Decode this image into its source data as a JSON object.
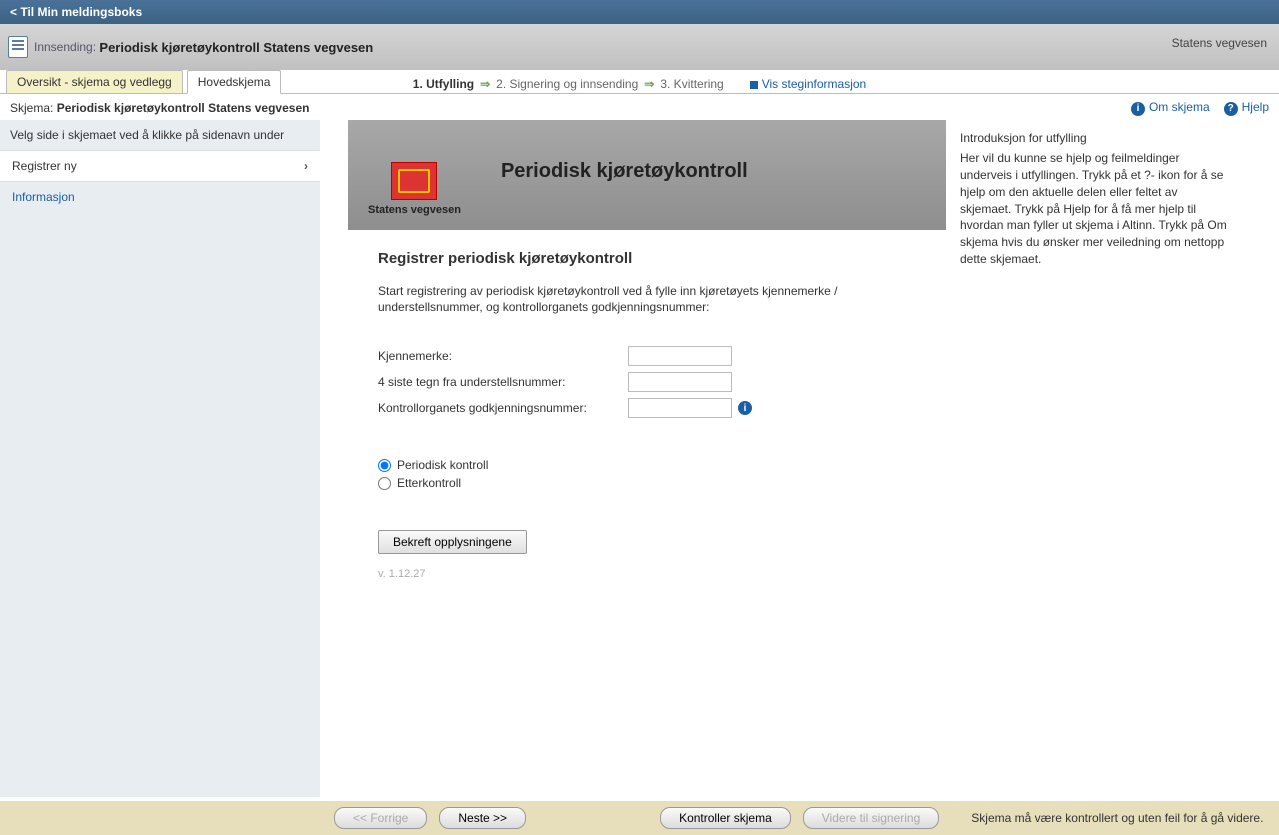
{
  "topbar": {
    "back_label": "< Til Min meldingsboks"
  },
  "header": {
    "prefix": "Innsending:",
    "title": "Periodisk kjøretøykontroll Statens vegvesen",
    "right": "Statens vegvesen"
  },
  "steps": {
    "s1": "1.  Utfylling",
    "s2": "2.  Signering og innsending",
    "s3": "3.  Kvittering",
    "info_link": "Vis steginformasjon"
  },
  "tabs": {
    "t1": "Oversikt - skjema og vedlegg",
    "t2": "Hovedskjema"
  },
  "schema_row": {
    "label": "Skjema:",
    "name": "Periodisk kjøretøykontroll Statens vegvesen",
    "om": "Om skjema",
    "hjelp": "Hjelp"
  },
  "leftnav": {
    "hint": "Velg side i skjemaet ved å klikke på sidenavn under",
    "item1": "Registrer ny",
    "item2": "Informasjon"
  },
  "banner": {
    "brand": "Statens vegvesen",
    "title": "Periodisk kjøretøykontroll"
  },
  "form": {
    "heading": "Registrer periodisk kjøretøykontroll",
    "desc": "Start registrering av periodisk kjøretøykontroll ved å fylle inn kjøretøyets kjennemerke / understellsnummer, og kontrollorganets godkjenningsnummer:",
    "f1_label": "Kjennemerke:",
    "f2_label": "4 siste tegn fra understellsnummer:",
    "f3_label": "Kontrollorganets godkjenningsnummer:",
    "r1": "Periodisk kontroll",
    "r2": "Etterkontroll",
    "submit": "Bekreft opplysningene",
    "version": "v. 1.12.27"
  },
  "right": {
    "title": "Introduksjon for utfylling",
    "text": "Her vil du kunne se hjelp og feilmeldinger underveis i utfyllingen. Trykk på et ?- ikon for å se hjelp om den aktuelle delen eller feltet av skjemaet. Trykk på Hjelp for å få mer hjelp til hvordan man fyller ut skjema i Altinn. Trykk på Om skjema hvis du ønsker mer veiledning om nettopp dette skjemaet."
  },
  "footer": {
    "prev": "<< Forrige",
    "next": "Neste >>",
    "check": "Kontroller skjema",
    "sign": "Videre til signering",
    "msg": "Skjema må være kontrollert og uten feil for å gå videre."
  }
}
